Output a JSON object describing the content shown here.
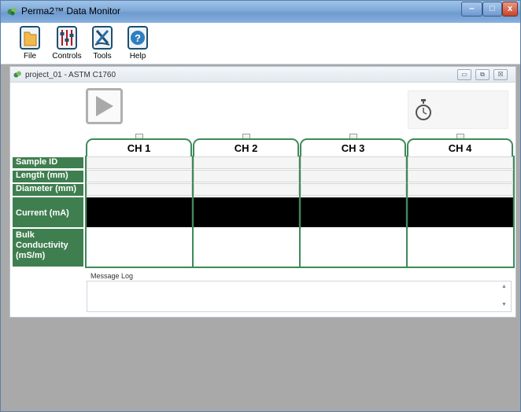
{
  "window": {
    "title": "Perma2™ Data Monitor",
    "controls": {
      "minimize": "‒",
      "maximize": "□",
      "close": "x"
    }
  },
  "toolbar": {
    "items": [
      {
        "label": "File"
      },
      {
        "label": "Controls"
      },
      {
        "label": "Tools"
      },
      {
        "label": "Help"
      }
    ]
  },
  "project": {
    "title": "project_01 - ASTM C1760",
    "controls": {
      "minimize": "▭",
      "restore": "⧉",
      "close": "☒"
    }
  },
  "channels": [
    "CH 1",
    "CH 2",
    "CH 3",
    "CH 4"
  ],
  "rows": [
    {
      "label": "Sample ID"
    },
    {
      "label": "Length (mm)"
    },
    {
      "label": "Diameter (mm)"
    },
    {
      "label": "Current (mA)"
    },
    {
      "label": "Bulk Conductivity (mS/m)"
    }
  ],
  "message_log": {
    "label": "Message Log"
  },
  "colors": {
    "accent_green": "#3f7e4f",
    "title_blue": "#7fa9d7"
  }
}
